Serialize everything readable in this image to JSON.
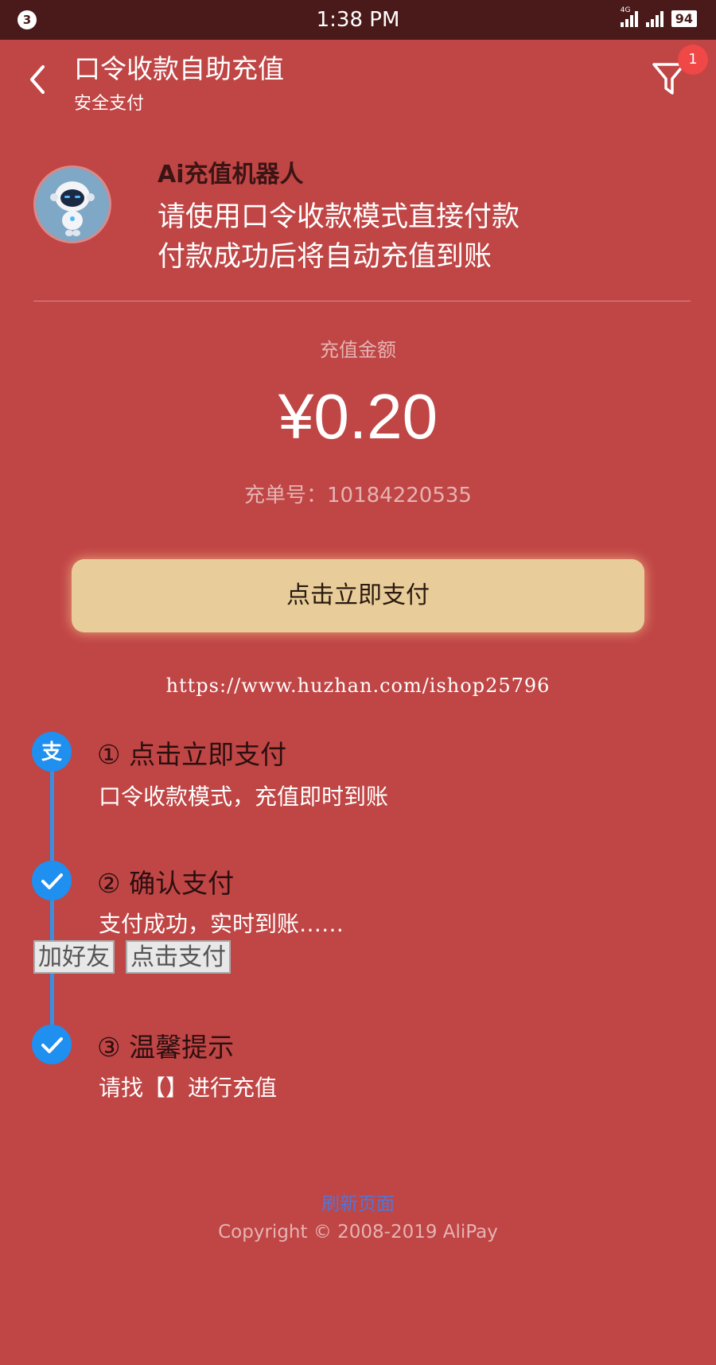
{
  "statusbar": {
    "notification_count": "3",
    "time": "1:38 PM",
    "network_label": "4G",
    "battery": "94"
  },
  "header": {
    "title": "口令收款自助充值",
    "subtitle": "安全支付",
    "filter_badge": "1",
    "icons": [
      "chevron-left-icon",
      "filter-icon"
    ]
  },
  "bot": {
    "name": "Ai充值机器人",
    "message_line1": "请使用口令收款模式直接付款",
    "message_line2": "付款成功后将自动充值到账"
  },
  "recharge": {
    "amount_label": "充值金额",
    "amount": "¥0.20",
    "order_no": "充单号：10184220535"
  },
  "pay_button": "点击立即支付",
  "watermark": "https://www.huzhan.com/ishop25796",
  "steps": [
    {
      "title": "① 点击立即支付",
      "desc": "口令收款模式，充值即时到账",
      "icon": "alipay-icon"
    },
    {
      "title": "② 确认支付",
      "desc": "支付成功，实时到账……",
      "icon": "check-icon"
    },
    {
      "title": "③ 温馨提示",
      "desc": "请找【】进行充值",
      "icon": "check-icon"
    }
  ],
  "buttons": {
    "add_friend": "加好友",
    "click_pay": "点击支付"
  },
  "footer": {
    "refresh": "刷新页面",
    "copyright": "Copyright © 2008-2019 AliPay"
  },
  "colors": {
    "background": "#c04545",
    "statusbar": "#4a1a1a",
    "pay_button": "#e8cd9a",
    "accent_blue": "#1f8ff0",
    "badge": "#f04747"
  }
}
